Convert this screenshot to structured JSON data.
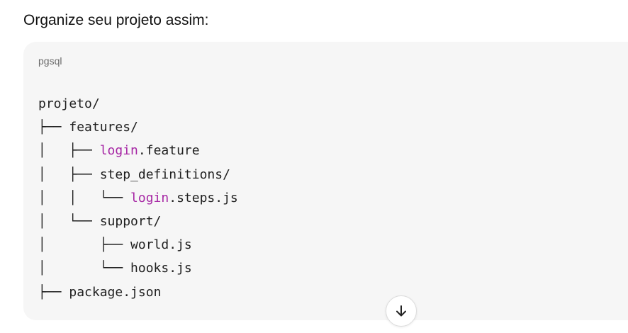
{
  "message": {
    "intro_text": "Organize seu projeto assim:"
  },
  "code_block": {
    "language": "pgsql",
    "lines": [
      {
        "prefix": "",
        "keyword": "",
        "rest": "projeto/"
      },
      {
        "prefix": "├── ",
        "keyword": "",
        "rest": "features/"
      },
      {
        "prefix": "│   ├── ",
        "keyword": "login",
        "rest": ".feature"
      },
      {
        "prefix": "│   ├── ",
        "keyword": "",
        "rest": "step_definitions/"
      },
      {
        "prefix": "│   │   └── ",
        "keyword": "login",
        "rest": ".steps.js"
      },
      {
        "prefix": "│   └── ",
        "keyword": "",
        "rest": "support/"
      },
      {
        "prefix": "│       ├── ",
        "keyword": "",
        "rest": "world.js"
      },
      {
        "prefix": "│       └── ",
        "keyword": "",
        "rest": "hooks.js"
      },
      {
        "prefix": "├── ",
        "keyword": "",
        "rest": "package.json"
      }
    ],
    "keyword_color": "#a626a4"
  },
  "scroll_button": {
    "icon": "arrow-down-icon"
  }
}
